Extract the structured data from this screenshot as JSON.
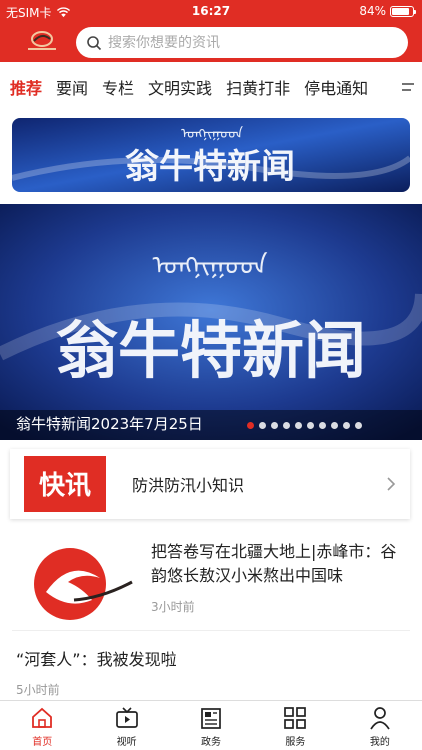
{
  "status": {
    "carrier": "无SIM卡",
    "time": "16:27",
    "battery": "84%",
    "battery_level": 0.84
  },
  "search": {
    "placeholder": "搜索你想要的资讯"
  },
  "tabs": [
    "推荐",
    "要闻",
    "专栏",
    "文明实践",
    "扫黄打非",
    "停电通知"
  ],
  "banner_small": {
    "mongolian_text": "ᠣᠩᠨᠢᠭᠤᠳ",
    "title": "翁牛特新闻"
  },
  "banner_big": {
    "mongolian_text": "ᠣᠩᠨᠢᠭᠤᠳ",
    "title": "翁牛特新闻",
    "caption": "翁牛特新闻2023年7月25日",
    "dots": 10,
    "active_dot": 0
  },
  "quick": {
    "badge": "快讯",
    "title": "防洪防汛小知识"
  },
  "news": [
    {
      "title": "把答卷写在北疆大地上|赤峰市：谷韵悠长敖汉小米熬出中国味",
      "time": "3小时前"
    },
    {
      "title": "“河套人”：我被发现啦",
      "time": "5小时前"
    }
  ],
  "bottom_nav": [
    {
      "label": "首页",
      "icon": "home-icon"
    },
    {
      "label": "视听",
      "icon": "video-icon"
    },
    {
      "label": "政务",
      "icon": "newspaper-icon"
    },
    {
      "label": "服务",
      "icon": "grid-icon"
    },
    {
      "label": "我的",
      "icon": "user-icon"
    }
  ],
  "colors": {
    "brand_red": "#e02d24",
    "banner_blue": "#1d3a8f"
  }
}
